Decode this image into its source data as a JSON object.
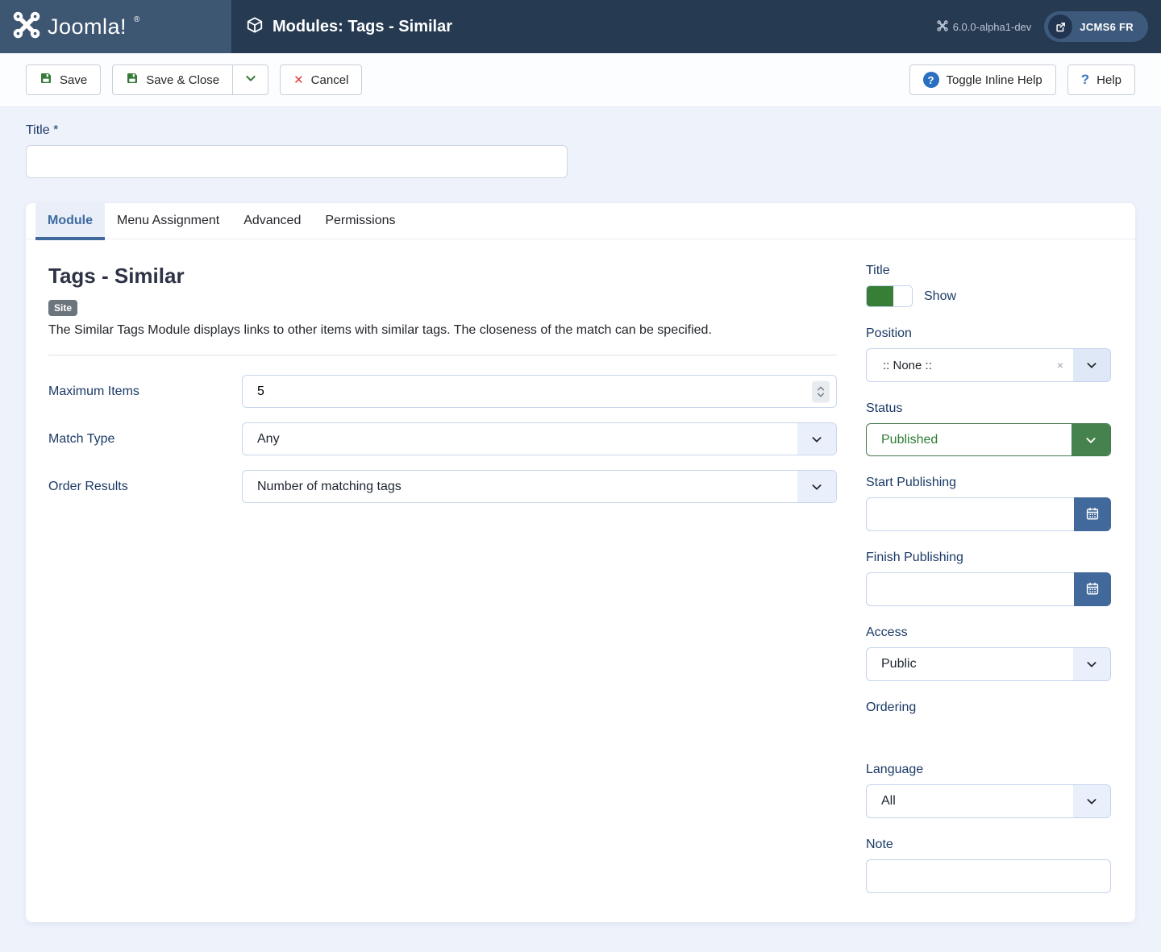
{
  "header": {
    "brand": "Joomla!",
    "brand_reg": "®",
    "page_title": "Modules: Tags - Similar",
    "version": "6.0.0-alpha1-dev",
    "site_button": "JCMS6 FR"
  },
  "toolbar": {
    "save": "Save",
    "save_and_close": "Save & Close",
    "cancel": "Cancel",
    "toggle_inline_help": "Toggle Inline Help",
    "help": "Help"
  },
  "title_field": {
    "label": "Title *",
    "value": ""
  },
  "tabs": {
    "module": "Module",
    "menu_assignment": "Menu Assignment",
    "advanced": "Advanced",
    "permissions": "Permissions"
  },
  "module_panel": {
    "heading": "Tags - Similar",
    "badge": "Site",
    "description": "The Similar Tags Module displays links to other items with similar tags. The closeness of the match can be specified.",
    "fields": {
      "maximum_items": {
        "label": "Maximum Items",
        "value": "5"
      },
      "match_type": {
        "label": "Match Type",
        "value": "Any"
      },
      "order_results": {
        "label": "Order Results",
        "value": "Number of matching tags"
      }
    }
  },
  "sidebar": {
    "title": {
      "label": "Title",
      "toggle_label": "Show"
    },
    "position": {
      "label": "Position",
      "value": ":: None ::"
    },
    "status": {
      "label": "Status",
      "value": "Published"
    },
    "start_publishing": {
      "label": "Start Publishing",
      "value": ""
    },
    "finish_publishing": {
      "label": "Finish Publishing",
      "value": ""
    },
    "access": {
      "label": "Access",
      "value": "Public"
    },
    "ordering": {
      "label": "Ordering"
    },
    "language": {
      "label": "Language",
      "value": "All"
    },
    "note": {
      "label": "Note",
      "value": ""
    }
  },
  "icons": {
    "question_mark": "?",
    "clear_x": "×",
    "cancel_x": "✕"
  },
  "colors": {
    "header_bg": "#263a52",
    "logo_bg": "#3d5671",
    "accent_blue": "#41699c",
    "success_green": "#377f37",
    "status_green": "#45824e",
    "danger_red": "#e03e3e",
    "help_blue": "#2b6fc0",
    "page_bg": "#eef2fb",
    "label_navy": "#1b3a66"
  }
}
